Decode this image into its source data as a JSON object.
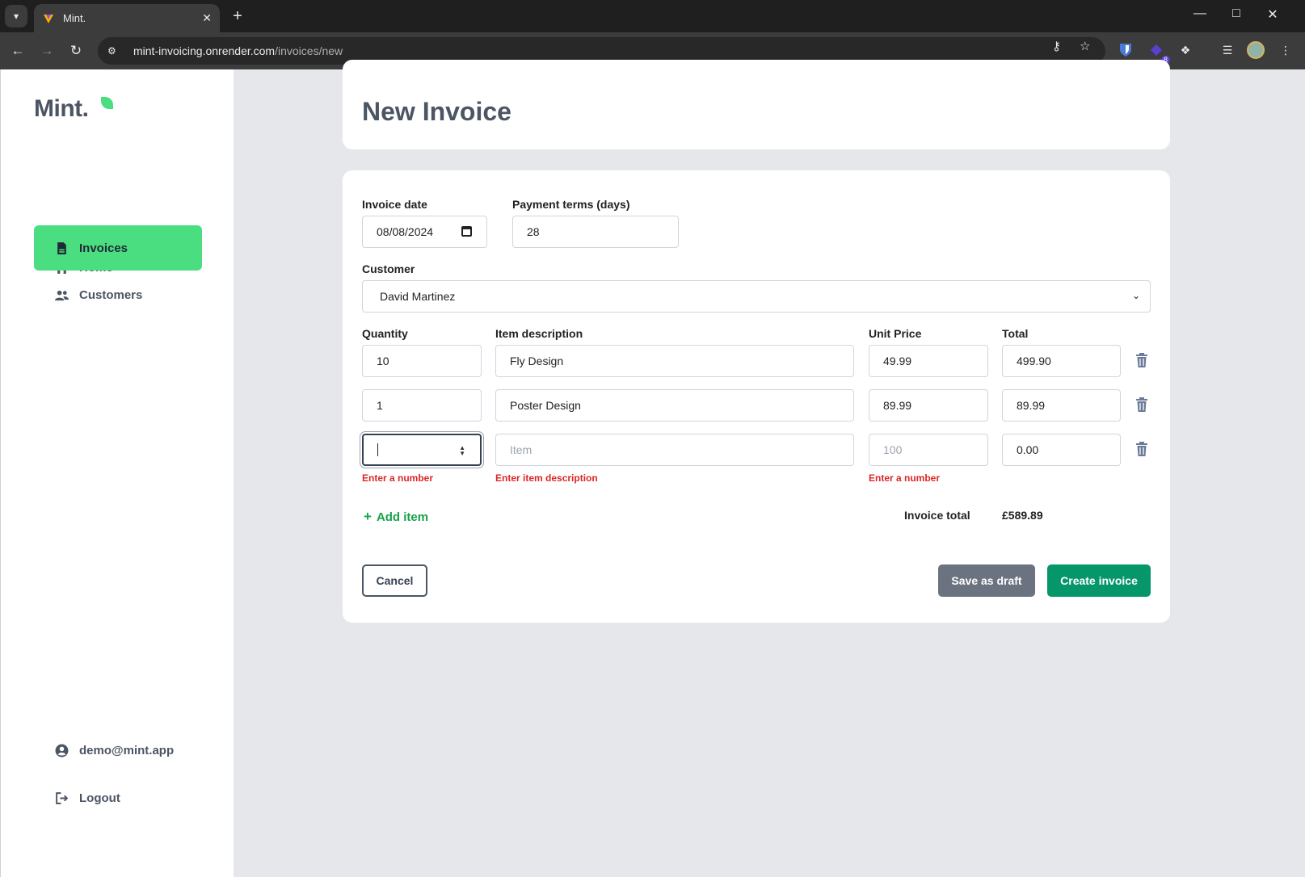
{
  "browser": {
    "tab_title": "Mint.",
    "url_host": "mint-invoicing.onrender.com",
    "url_path": "/invoices/new",
    "extension_badge": "8"
  },
  "sidebar": {
    "logo": "Mint.",
    "items": [
      {
        "label": "Home",
        "icon": "home-icon",
        "active": false
      },
      {
        "label": "Invoices",
        "icon": "document-icon",
        "active": true
      },
      {
        "label": "Customers",
        "icon": "users-icon",
        "active": false
      }
    ],
    "user_email": "demo@mint.app",
    "logout_label": "Logout"
  },
  "page": {
    "title": "New Invoice"
  },
  "form": {
    "invoice_date_label": "Invoice date",
    "invoice_date_value": "08/08/2024",
    "payment_terms_label": "Payment terms (days)",
    "payment_terms_value": "28",
    "customer_label": "Customer",
    "customer_value": "David Martinez",
    "columns": {
      "quantity": "Quantity",
      "description": "Item description",
      "unit_price": "Unit Price",
      "total": "Total"
    },
    "items": [
      {
        "quantity": "10",
        "description": "Fly Design",
        "unit_price": "49.99",
        "total": "499.90"
      },
      {
        "quantity": "1",
        "description": "Poster Design",
        "unit_price": "89.99",
        "total": "89.99"
      },
      {
        "quantity": "",
        "description": "",
        "unit_price": "",
        "total": "0.00",
        "description_placeholder": "Item",
        "unit_price_placeholder": "100",
        "errors": {
          "quantity": "Enter a number",
          "description": "Enter item description",
          "unit_price": "Enter a number"
        }
      }
    ],
    "add_item_label": "Add item",
    "invoice_total_label": "Invoice total",
    "invoice_total_value": "£589.89",
    "cancel_label": "Cancel",
    "save_draft_label": "Save as draft",
    "create_label": "Create invoice"
  },
  "colors": {
    "accent": "#4ade80",
    "primary_button": "#059669",
    "secondary_button": "#6b7280",
    "error": "#dc2626",
    "background": "#e5e7eb"
  }
}
